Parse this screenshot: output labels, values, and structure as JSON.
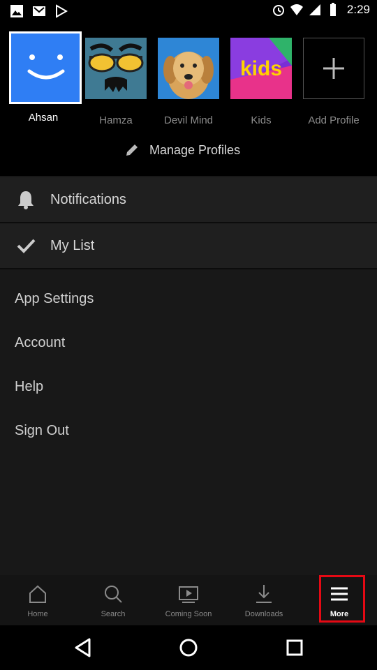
{
  "status_bar": {
    "time": "2:29"
  },
  "profiles": [
    {
      "name": "Ahsan",
      "active": true
    },
    {
      "name": "Hamza",
      "active": false
    },
    {
      "name": "Devil Mind",
      "active": false
    },
    {
      "name": "Kids",
      "active": false,
      "avatar_text": "kids"
    },
    {
      "name": "Add Profile",
      "active": false
    }
  ],
  "manage_profiles": {
    "label": "Manage Profiles"
  },
  "menu": {
    "notifications": "Notifications",
    "my_list": "My List",
    "app_settings": "App Settings",
    "account": "Account",
    "help": "Help",
    "sign_out": "Sign Out"
  },
  "tabs": [
    {
      "label": "Home",
      "icon": "home-icon"
    },
    {
      "label": "Search",
      "icon": "search-icon"
    },
    {
      "label": "Coming Soon",
      "icon": "play-screen-icon"
    },
    {
      "label": "Downloads",
      "icon": "download-icon"
    },
    {
      "label": "More",
      "icon": "menu-icon",
      "active": true
    }
  ],
  "colors": {
    "highlight": "#e50914",
    "ahsan_avatar": "#2f7ef4",
    "menu_bg": "#1f1f1f"
  }
}
